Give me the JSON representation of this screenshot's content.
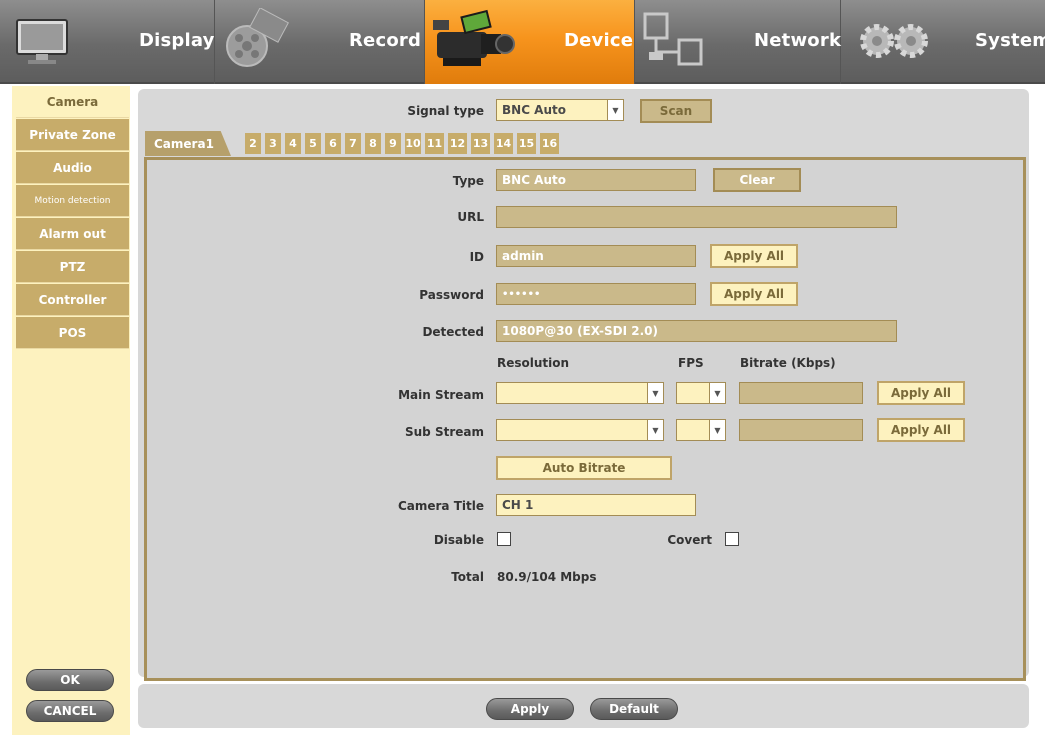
{
  "nav": {
    "tabs": [
      {
        "label": "Display",
        "icon": "monitor-icon"
      },
      {
        "label": "Record",
        "icon": "film-reel-icon"
      },
      {
        "label": "Device",
        "icon": "video-camera-icon",
        "active": true
      },
      {
        "label": "Network",
        "icon": "network-icon"
      },
      {
        "label": "System",
        "icon": "gears-icon"
      }
    ]
  },
  "sidebar": {
    "items": [
      {
        "label": "Camera",
        "active": true
      },
      {
        "label": "Private Zone"
      },
      {
        "label": "Audio"
      },
      {
        "label": "Motion detection"
      },
      {
        "label": "Alarm out"
      },
      {
        "label": "PTZ"
      },
      {
        "label": "Controller"
      },
      {
        "label": "POS"
      }
    ],
    "ok_label": "OK",
    "cancel_label": "CANCEL"
  },
  "signal": {
    "label": "Signal type",
    "value": "BNC Auto",
    "scan_label": "Scan"
  },
  "camera_tabs": {
    "first": "Camera1",
    "numbers": [
      "2",
      "3",
      "4",
      "5",
      "6",
      "7",
      "8",
      "9",
      "10",
      "11",
      "12",
      "13",
      "14",
      "15",
      "16"
    ]
  },
  "form": {
    "type_label": "Type",
    "type_value": "BNC Auto",
    "clear_label": "Clear",
    "url_label": "URL",
    "url_value": "",
    "id_label": "ID",
    "id_value": "admin",
    "password_label": "Password",
    "password_value": "••••••",
    "apply_all_label": "Apply All",
    "detected_label": "Detected",
    "detected_value": "1080P@30 (EX-SDI 2.0)",
    "resolution_header": "Resolution",
    "fps_header": "FPS",
    "bitrate_header": "Bitrate (Kbps)",
    "main_stream_label": "Main Stream",
    "sub_stream_label": "Sub Stream",
    "auto_bitrate_label": "Auto Bitrate",
    "camera_title_label": "Camera Title",
    "camera_title_value": "CH 1",
    "disable_label": "Disable",
    "covert_label": "Covert",
    "total_label": "Total",
    "total_value": "80.9/104 Mbps"
  },
  "footer": {
    "apply_label": "Apply",
    "default_label": "Default"
  },
  "colors": {
    "active_tab": "#f7941d",
    "gold": "#c7ac6a",
    "cream": "#fdf2bf"
  }
}
